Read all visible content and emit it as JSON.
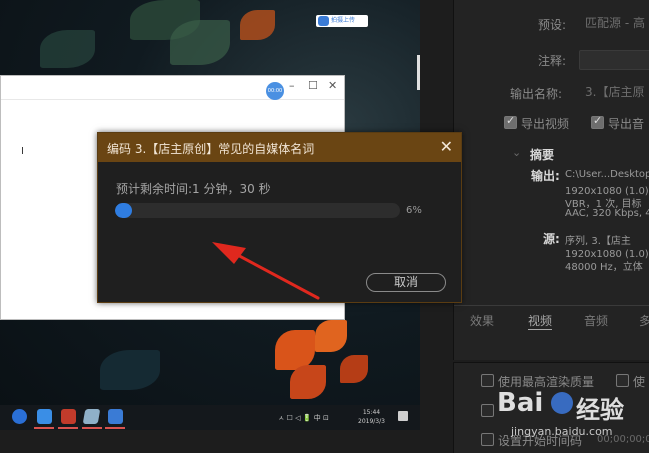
{
  "desktop": {
    "upload_badge": "拍摄上传",
    "avatar_text": "00:00",
    "window_controls": {
      "minimize": "–",
      "maximize": "☐",
      "close": "✕"
    },
    "text_cursor": "I",
    "taskbar": {
      "tray_text": "ㅅ ☐ ◁ 🔋 中 ⊡",
      "time": "15:44",
      "date": "2019/3/3"
    }
  },
  "dialog": {
    "title": "编码 3.【店主原创】常见的自媒体名词",
    "eta": "预计剩余时间:1 分钟，30 秒",
    "progress_percent": 6,
    "progress_label": "6%",
    "cancel_label": "取消"
  },
  "export_panel": {
    "preset_label": "预设:",
    "preset_value": "匹配源 - 高",
    "comment_label": "注释:",
    "output_name_label": "输出名称:",
    "output_name_value": "3.【店主原",
    "export_video_label": "导出视频",
    "export_audio_label": "导出音",
    "summary_label": "摘要",
    "output_label": "输出:",
    "output_lines": [
      "C:\\User...Desktop\\",
      "1920x1080 (1.0)，",
      "VBR，1 次, 目标",
      "AAC, 320 Kbps, 48"
    ],
    "source_label": "源:",
    "source_lines": [
      "序列, 3.【店主",
      "1920x1080 (1.0)，",
      "48000 Hz，立体"
    ],
    "tabs": [
      "效果",
      "视频",
      "音频",
      "多"
    ],
    "active_tab": "视频",
    "use_max_quality": "使用最高渲染质量",
    "use_prefix": "使",
    "timecode_label": "设置开始时间码",
    "timecode_value": "00;00;00;00"
  },
  "watermark": {
    "logo": "Bai",
    "logo_suffix": "经验",
    "url": "jingyan.baidu.com"
  }
}
